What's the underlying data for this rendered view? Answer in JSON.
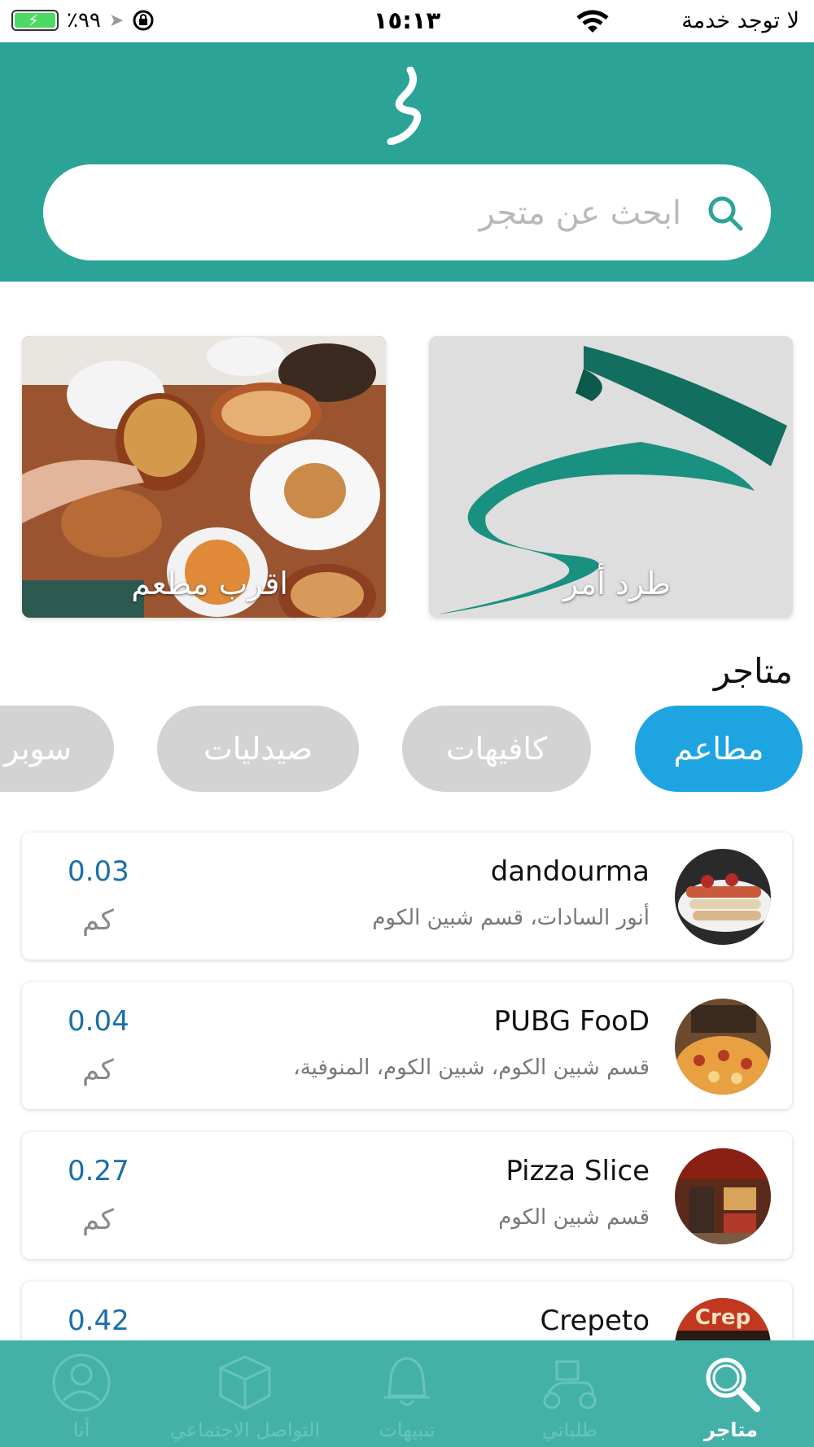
{
  "status_bar": {
    "carrier": "لا توجد خدمة",
    "time": "١٥:١٣",
    "battery": "٪٩٩"
  },
  "search": {
    "placeholder": "ابحث عن متجر"
  },
  "banners": [
    {
      "label": "طرد أمر"
    },
    {
      "label": "اقرب مطعم"
    }
  ],
  "stores_section": {
    "title": "متاجر",
    "chips": [
      {
        "label": "مطاعم",
        "active": true
      },
      {
        "label": "كافيهات",
        "active": false
      },
      {
        "label": "صيدليات",
        "active": false
      },
      {
        "label": "سوبر",
        "active": false
      }
    ]
  },
  "stores": [
    {
      "name": "dandourma",
      "address": "أنور السادات، قسم شبين الكوم",
      "distance": "0.03",
      "unit": "كم"
    },
    {
      "name": "PUBG FooD",
      "address": "قسم شبين الكوم، شبين الكوم، المنوفية،",
      "distance": "0.04",
      "unit": "كم"
    },
    {
      "name": "Pizza Slice",
      "address": "قسم شبين الكوم",
      "distance": "0.27",
      "unit": "كم"
    },
    {
      "name": "Crepeto",
      "address": "",
      "distance": "0.42",
      "unit": "كم"
    }
  ],
  "tabbar": {
    "items": [
      {
        "label": "متاجر",
        "icon": "search-icon",
        "active": true
      },
      {
        "label": "طلباتي",
        "icon": "delivery-bike-icon",
        "active": false
      },
      {
        "label": "تنبيهات",
        "icon": "bell-icon",
        "active": false
      },
      {
        "label": "التواصل الاجتماعي",
        "icon": "box-icon",
        "active": false
      },
      {
        "label": "أنا",
        "icon": "user-icon",
        "active": false
      }
    ]
  },
  "colors": {
    "brand": "#2ba396",
    "tabbar": "#44b1a8",
    "chip_active": "#1ea5e1",
    "chip_inactive": "#d3d3d3",
    "distance": "#1a6fa8"
  }
}
